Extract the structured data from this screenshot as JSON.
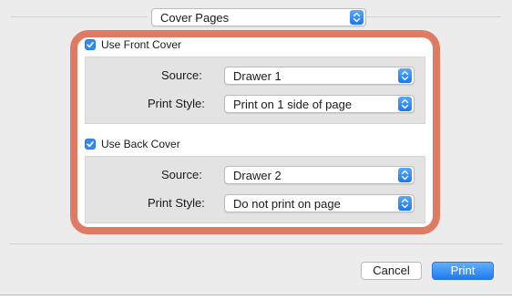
{
  "section_popup": {
    "selected": "Cover Pages"
  },
  "front_cover": {
    "checkbox_label": "Use Front Cover",
    "checked": true,
    "source_label": "Source:",
    "source_value": "Drawer 1",
    "print_style_label": "Print Style:",
    "print_style_value": "Print on 1 side of page"
  },
  "back_cover": {
    "checkbox_label": "Use Back Cover",
    "checked": true,
    "source_label": "Source:",
    "source_value": "Drawer 2",
    "print_style_label": "Print Style:",
    "print_style_value": "Do not print on page"
  },
  "buttons": {
    "cancel": "Cancel",
    "print": "Print"
  },
  "colors": {
    "highlight_border": "#e07b63",
    "accent_blue": "#1f7cf0",
    "dialog_bg": "#ececec"
  },
  "icons": {
    "popup_arrows": "up-down-chevrons-icon",
    "checkmark": "checkmark-icon"
  }
}
